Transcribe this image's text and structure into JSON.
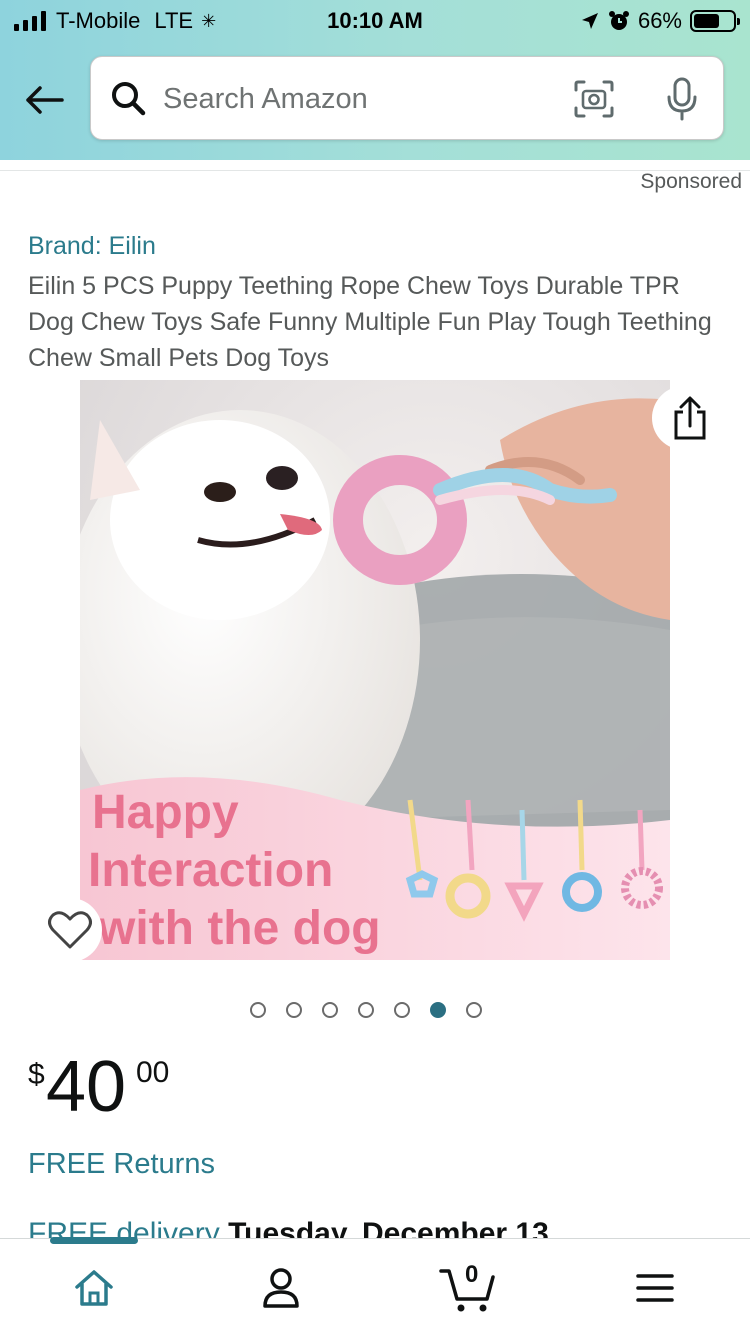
{
  "status_bar": {
    "carrier": "T-Mobile",
    "network": "LTE",
    "time": "10:10 AM",
    "battery_percent": "66%",
    "battery_level": 0.66
  },
  "search": {
    "placeholder": "Search Amazon"
  },
  "product": {
    "sponsored": "Sponsored",
    "brand": "Brand: Eilin",
    "title": "Eilin 5 PCS Puppy Teething Rope Chew Toys Durable TPR Dog Chew Toys Safe Funny Multiple Fun Play Tough Teething Chew Small Pets Dog Toys",
    "image_caption_lines": [
      "Happy",
      "Interaction",
      "with the dog"
    ],
    "carousel": {
      "count": 7,
      "active_index": 5
    },
    "price": {
      "symbol": "$",
      "whole": "40",
      "fraction": "00"
    },
    "free_returns": "FREE Returns",
    "delivery_prefix": "FREE delivery ",
    "delivery_date": "Tuesday, December 13"
  },
  "tab_bar": {
    "items": [
      "home-icon",
      "account-icon",
      "cart-icon",
      "menu-icon"
    ],
    "active": "home",
    "cart_count": "0"
  },
  "colors": {
    "accent": "#2b7b8c",
    "header_gradient_start": "#8ed3dd",
    "header_gradient_end": "#a9e4cf",
    "caption_pink": "#e8728f"
  }
}
